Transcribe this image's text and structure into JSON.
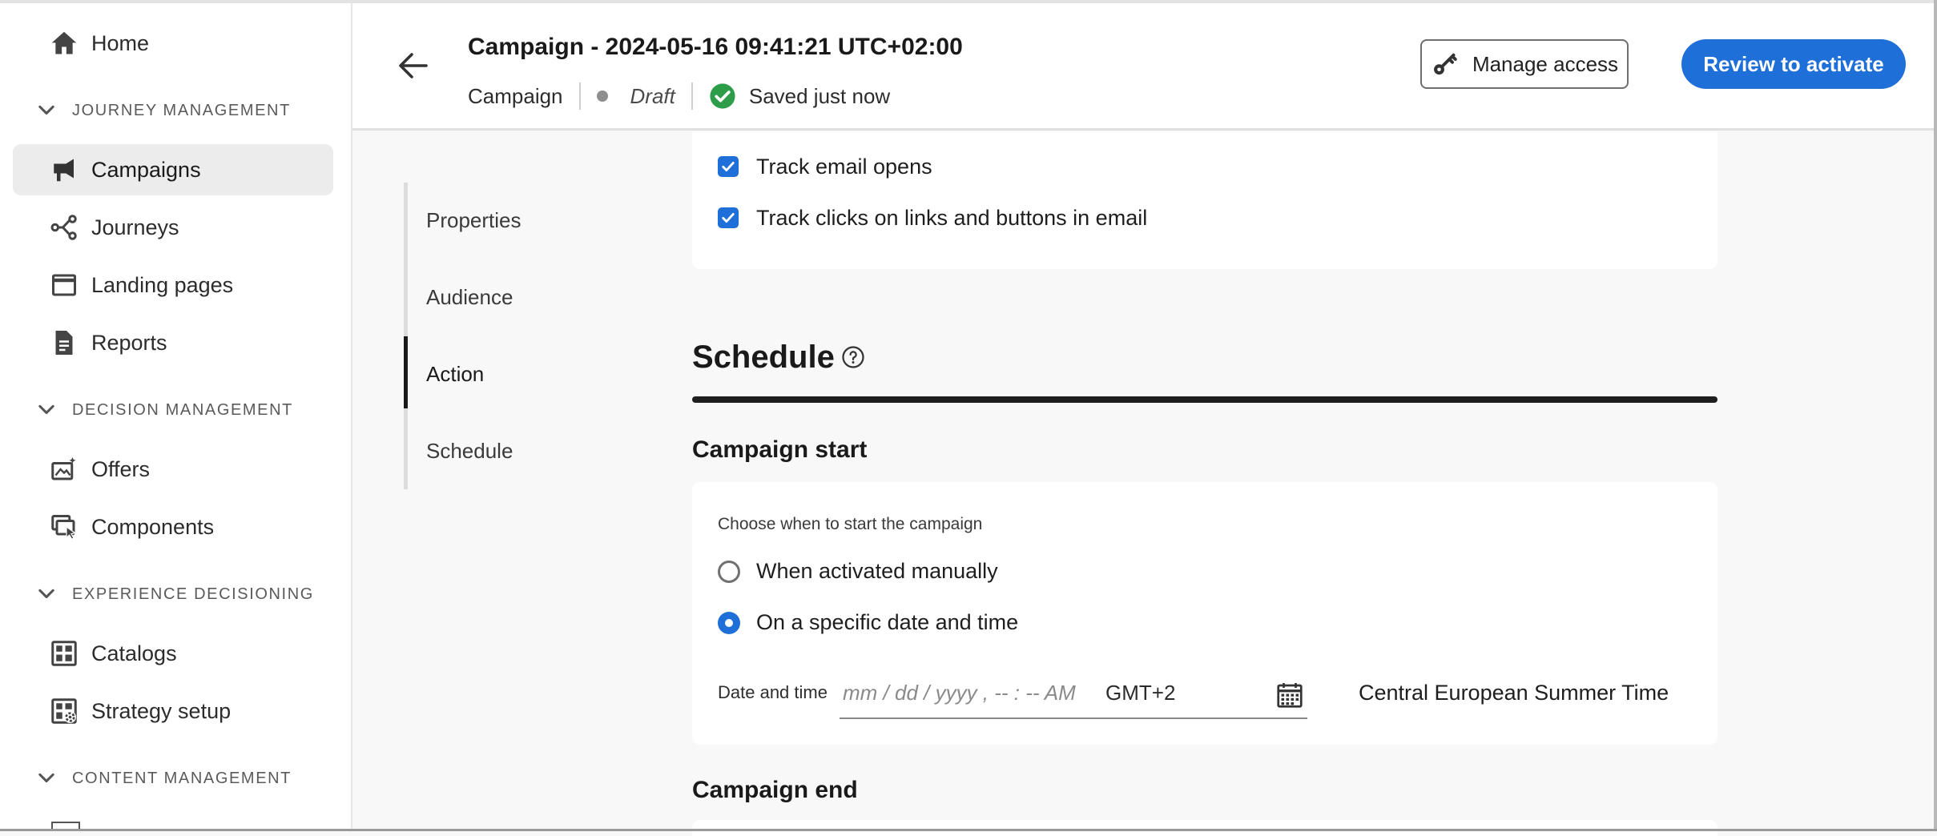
{
  "sidebar": {
    "home": "Home",
    "sections": {
      "journey": "JOURNEY MANAGEMENT",
      "decision": "DECISION MANAGEMENT",
      "experience": "EXPERIENCE DECISIONING",
      "content": "CONTENT MANAGEMENT"
    },
    "items": {
      "campaigns": "Campaigns",
      "journeys": "Journeys",
      "landing_pages": "Landing pages",
      "reports": "Reports",
      "offers": "Offers",
      "components": "Components",
      "catalogs": "Catalogs",
      "strategy_setup": "Strategy setup"
    },
    "active_item": "Campaigns"
  },
  "header": {
    "title": "Campaign - 2024-05-16 09:41:21 UTC+02:00",
    "type": "Campaign",
    "status": "Draft",
    "saved": "Saved just now",
    "manage_access": "Manage access",
    "review": "Review to activate"
  },
  "steps": [
    "Properties",
    "Audience",
    "Action",
    "Schedule"
  ],
  "active_step": "Action",
  "tracking": {
    "opens": "Track email opens",
    "clicks": "Track clicks on links and buttons in email"
  },
  "schedule": {
    "title": "Schedule",
    "start": {
      "heading": "Campaign start",
      "hint": "Choose when to start the campaign",
      "options": [
        "When activated manually",
        "On a specific date and time"
      ],
      "selected": "On a specific date and time",
      "date_label": "Date and time",
      "date_placeholder": "mm / dd / yyyy ,  -- : --  AM",
      "tz_offset": "GMT+2",
      "tz_name": "Central European Summer Time"
    },
    "end": {
      "heading": "Campaign end"
    }
  },
  "colors": {
    "accent": "#1f6fd8",
    "success": "#2d9d4a"
  }
}
